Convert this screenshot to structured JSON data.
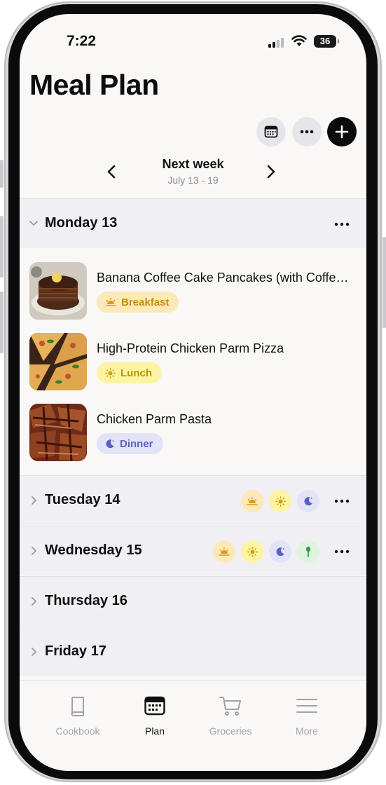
{
  "status_bar": {
    "time": "7:22",
    "battery": "36"
  },
  "header": {
    "title": "Meal Plan"
  },
  "week_nav": {
    "title": "Next week",
    "range": "July 13 - 19"
  },
  "days": [
    {
      "name": "Monday 13",
      "expanded": true
    },
    {
      "name": "Tuesday 14",
      "expanded": false
    },
    {
      "name": "Wednesday 15",
      "expanded": false
    },
    {
      "name": "Thursday 16",
      "expanded": false
    },
    {
      "name": "Friday 17",
      "expanded": false
    }
  ],
  "meals": [
    {
      "name": "Banana Coffee Cake Pancakes (with Coffee Glaze)",
      "tag": "Breakfast",
      "tag_color": "#fde9b8",
      "tag_text": "#c98a14",
      "icon": "sunrise-icon"
    },
    {
      "name": "High-Protein Chicken Parm Pizza",
      "tag": "Lunch",
      "tag_color": "#fcf4a3",
      "tag_text": "#b8970b",
      "icon": "sun-icon"
    },
    {
      "name": "Chicken Parm Pasta",
      "tag": "Dinner",
      "tag_color": "#e2e3f7",
      "tag_text": "#5a5fc7",
      "icon": "moon-icon"
    }
  ],
  "tabs": [
    {
      "label": "Cookbook",
      "icon": "book-icon",
      "active": false
    },
    {
      "label": "Plan",
      "icon": "calendar-icon",
      "active": true
    },
    {
      "label": "Groceries",
      "icon": "cart-icon",
      "active": false
    },
    {
      "label": "More",
      "icon": "menu-icon",
      "active": false
    }
  ],
  "colors": {
    "breakfast": "#fde9b8",
    "lunch": "#fcf4a3",
    "dinner": "#e2e3f7",
    "snack": "#dff3df",
    "accent": "#0b0b0b"
  }
}
